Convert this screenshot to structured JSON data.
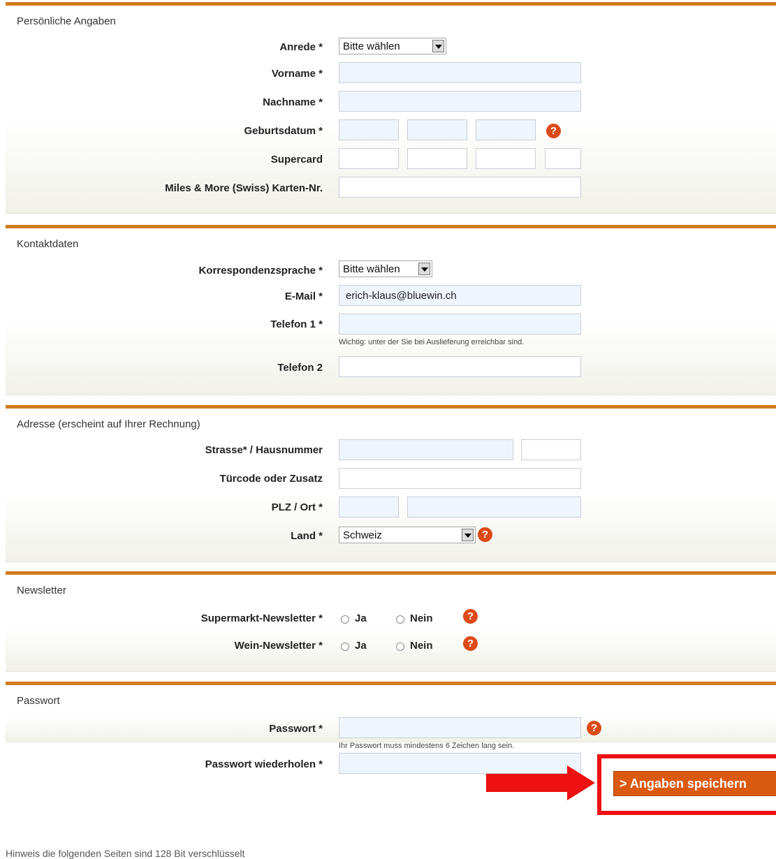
{
  "sections": {
    "personal": {
      "title": "Persönliche Angaben",
      "salutation_label": "Anrede *",
      "salutation_value": "Bitte wählen",
      "firstname_label": "Vorname *",
      "lastname_label": "Nachname *",
      "birthdate_label": "Geburtsdatum *",
      "supercard_label": "Supercard",
      "miles_label": "Miles & More (Swiss) Karten-Nr."
    },
    "contact": {
      "title": "Kontaktdaten",
      "language_label": "Korrespondenzsprache *",
      "language_value": "Bitte wählen",
      "email_label": "E-Mail *",
      "email_value": "erich-klaus@bluewin.ch",
      "phone1_label": "Telefon 1 *",
      "phone1_hint": "Wichtig: unter der Sie bei Auslieferung erreichbar sind.",
      "phone2_label": "Telefon 2"
    },
    "address": {
      "title": "Adresse (erscheint auf Ihrer Rechnung)",
      "street_label": "Strasse* / Hausnummer",
      "extra_label": "Türcode oder Zusatz",
      "zip_label": "PLZ / Ort *",
      "country_label": "Land *",
      "country_value": "Schweiz"
    },
    "newsletter": {
      "title": "Newsletter",
      "supermarket_label": "Supermarkt-Newsletter *",
      "wine_label": "Wein-Newsletter *",
      "yes_label": "Ja",
      "no_label": "Nein"
    },
    "password": {
      "title": "Passwort",
      "password_label": "Passwort *",
      "password_hint": "Ihr Passwort muss mindestens 6 Zeichen lang sein.",
      "repeat_label": "Passwort wiederholen *"
    }
  },
  "help_icon": "?",
  "save_button": "> Angaben speichern",
  "footer_note": "Hinweis die folgenden Seiten sind 128 Bit verschlüsselt",
  "colors": {
    "accent": "#d27a1f",
    "button": "#db5a12",
    "help": "#dc4a18",
    "highlight": "#ee1111",
    "input_bg": "#eef5fd"
  },
  "icons": {
    "help": "question-circle-icon",
    "annotation": "red-arrow-right-icon"
  }
}
